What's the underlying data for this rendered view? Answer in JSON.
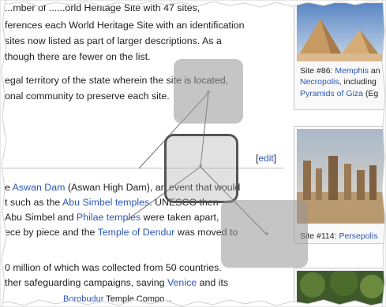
{
  "article": {
    "line1_pre": "...mber of ...",
    "line1_post": "...orld Heritage Site with 47 sites,",
    "line2": "ferences each World Heritage Site with an identification",
    "line3": "sites now listed as part of larger descriptions. As a",
    "line4": "though there are fewer on the list.",
    "line5": "egal territory of the state wherein the site is located,",
    "line6": "onal community to preserve each site.",
    "edit_bracket_open": "[",
    "edit_link": "edit",
    "edit_bracket_close": "]",
    "p2_l1_a": "e ",
    "p2_l1_link": "Aswan Dam",
    "p2_l1_b": " (Aswan High Dam), an event that would",
    "p2_l2_a": "t such as the ",
    "p2_l2_link": "Abu Simbel temples",
    "p2_l2_b": ". UNESCO then",
    "p2_l3_a": "Abu Simbel and ",
    "p2_l3_link": "Philae temples",
    "p2_l3_b": " were taken apart,",
    "p2_l4_a": "ece by piece and the ",
    "p2_l4_link": "Temple of Dendur",
    "p2_l4_b": " was moved to",
    "p3_l1": "0 million of which was collected from 50 countries.",
    "p3_l2_a": "ther safeguarding campaigns, saving ",
    "p3_l2_link": "Venice",
    "p3_l2_b": " and its",
    "p3_l3_a": "",
    "p3_l3_link": "Borobudur",
    "p3_l3_b": " Temple Compo..."
  },
  "sidebar": {
    "cap1_a": "Site #86: ",
    "cap1_link1": "Memphis",
    "cap1_b": " an",
    "cap1_link2": "Necropolis",
    "cap1_c": ", including",
    "cap1_link3": "Pyramids of Giza",
    "cap1_d": " (Eg",
    "cap2_a": "Site #114: ",
    "cap2_link": "Persepolis"
  },
  "colors": {
    "link": "#2a55b8",
    "text": "#222222",
    "overlay": "#969696",
    "overlay_border": "#555555"
  }
}
